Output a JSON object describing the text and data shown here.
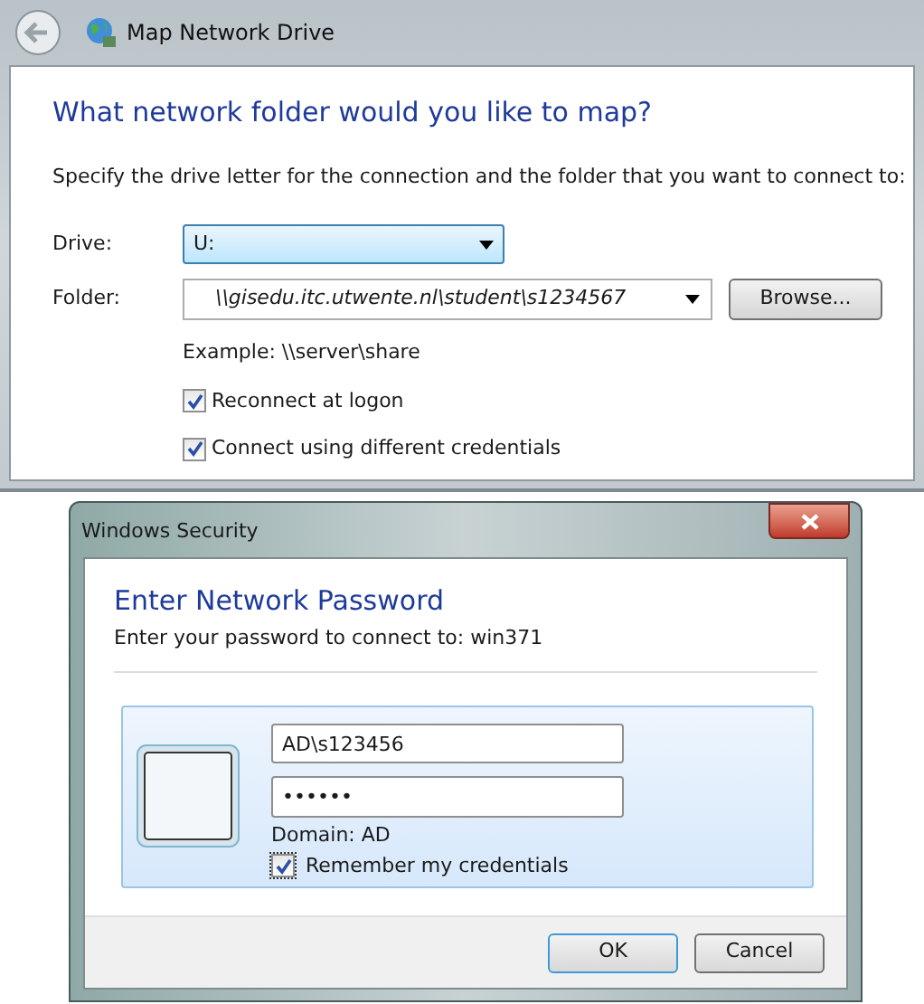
{
  "map_drive": {
    "title": "Map Network Drive",
    "heading": "What network folder would you like to map?",
    "instructions": "Specify the drive letter for the connection and the folder that you want to connect to:",
    "drive": {
      "label": "Drive:",
      "value": "U:"
    },
    "folder": {
      "label": "Folder:",
      "value": "\\\\gisedu.itc.utwente.nl\\student\\s1234567"
    },
    "browse_button": "Browse...",
    "example": "Example: \\\\server\\share",
    "options": [
      {
        "label": "Reconnect at logon",
        "checked": true
      },
      {
        "label": "Connect using different credentials",
        "checked": true
      }
    ]
  },
  "security": {
    "title": "Windows Security",
    "heading": "Enter Network Password",
    "subheading": "Enter your password to connect to: win371",
    "username": {
      "value": "AD\\s123456"
    },
    "password": {
      "value": "••••••"
    },
    "domain": "Domain: AD",
    "remember": {
      "label": "Remember my credentials",
      "checked": true
    },
    "buttons": [
      "OK",
      "Cancel"
    ]
  }
}
